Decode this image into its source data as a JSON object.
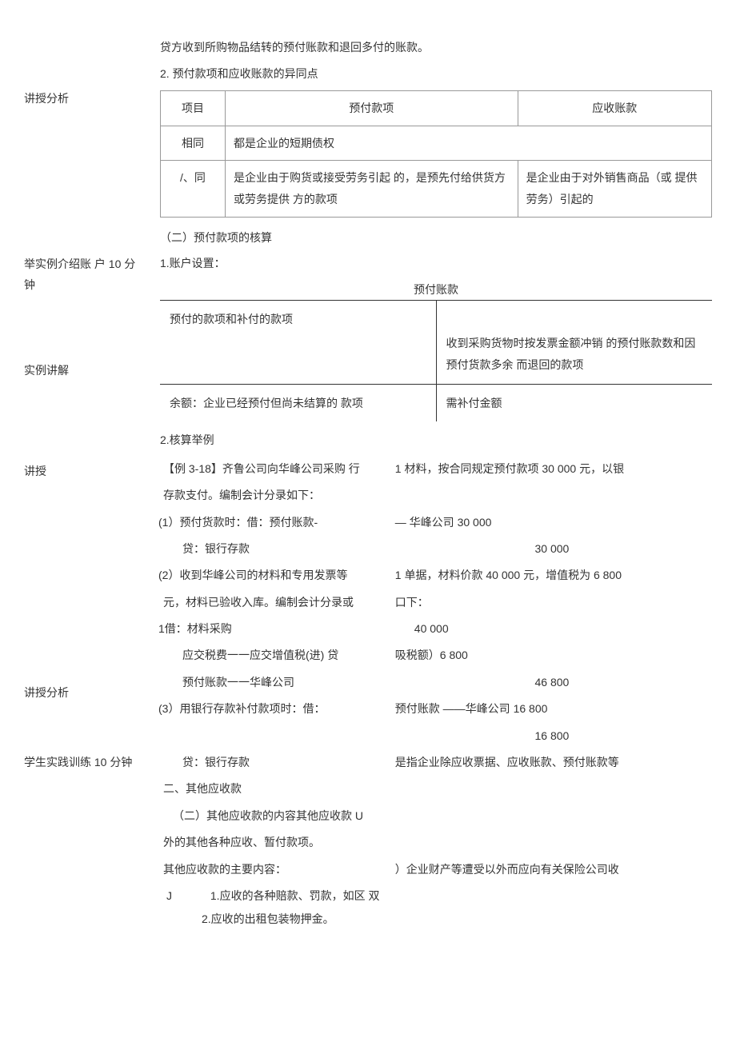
{
  "left": {
    "n1": "讲授分析",
    "n2": "举实例介绍账 户 10 分钟",
    "n3": "实例讲解",
    "n4": "讲授",
    "n5": "讲授分析",
    "n6": "学生实践训练 10 分钟"
  },
  "body": {
    "p1": "贷方收到所购物品结转的预付账款和退回多付的账款。",
    "p2": "2. 预付款项和应收账款的异同点",
    "tbl": {
      "h1": "项目",
      "h2": "预付款项",
      "h3": "应收账款",
      "r1c1": "相同",
      "r1c2": "都是企业的短期债权",
      "r2c1": "/、同",
      "r2c2": "是企业由于购货或接受劳务引起 的，是预先付给供货方或劳务提供 方的款项",
      "r2c3": "是企业由于对外销售商品（或 提供劳务）引起的"
    },
    "p3": "（二）预付款项的核算",
    "p4": "1.账户设置：",
    "tacct_title": "预付账款",
    "tacct": {
      "tl": "预付的款项和补付的款项",
      "tr": "收到采购货物时按发票金额冲销 的预付账款数和因预付货款多余 而退回的款项",
      "bl": "余额：企业已经预付但尚未结算的 款项",
      "br": "需补付金额"
    },
    "p5": "2.核算举例",
    "ex_intro_l": "【例 3-18】齐鲁公司向华峰公司采购 行",
    "ex_intro_r": "1 材料，按合同规定预付款项 30 000 元，以银",
    "ex_intro_2": "存款支付。编制会计分录如下：",
    "ex1_l": "1）预付货款时：借：预付账款-",
    "ex1_r": "— 华峰公司 30 000",
    "ex1_credit_l": "贷：银行存款",
    "ex1_credit_r": "30 000",
    "ex2_l": "2）收到华峰公司的材料和专用发票等",
    "ex2_r": "1 单据，材料价款 40 000 元，增值税为 6 800",
    "ex2_2l": "元，材料已验收入库。编制会计分录或",
    "ex2_2r": "口下：",
    "ex2_dr1_l": "借：材料采购",
    "ex2_dr1_r": "40 000",
    "ex2_dr2_l": "应交税费一一应交增值税(进)   贷",
    "ex2_dr2_r": "吸税额）6 800",
    "ex2_cr_l": "预付账款一一华峰公司",
    "ex2_cr_r": "46 800",
    "ex3_l": "3）用银行存款补付款项时：借：",
    "ex3_r": "预付账款 ——华峰公司 16 800",
    "ex3_cr_l": "贷：银行存款",
    "ex3_cr_r": "16 800",
    "sec2_h": "二、其他应收款",
    "sec2_r": "是指企业除应收票据、应收账款、预付账款等",
    "sec2_l2": "（二）其他应收款的内容其他应收款 U",
    "sec2_l3": "外的其他各种应收、暂付款项。",
    "sec2_l4": "其他应收款的主要内容：",
    "sec2_r4": "）企业财产等遭受以外而应向有关保险公司收",
    "sec2_i1": "1.应收的各种赔款、罚款，如区 双",
    "sec2_i2": "2.应收的出租包装物押金。",
    "lp": "(",
    "j": "J"
  }
}
